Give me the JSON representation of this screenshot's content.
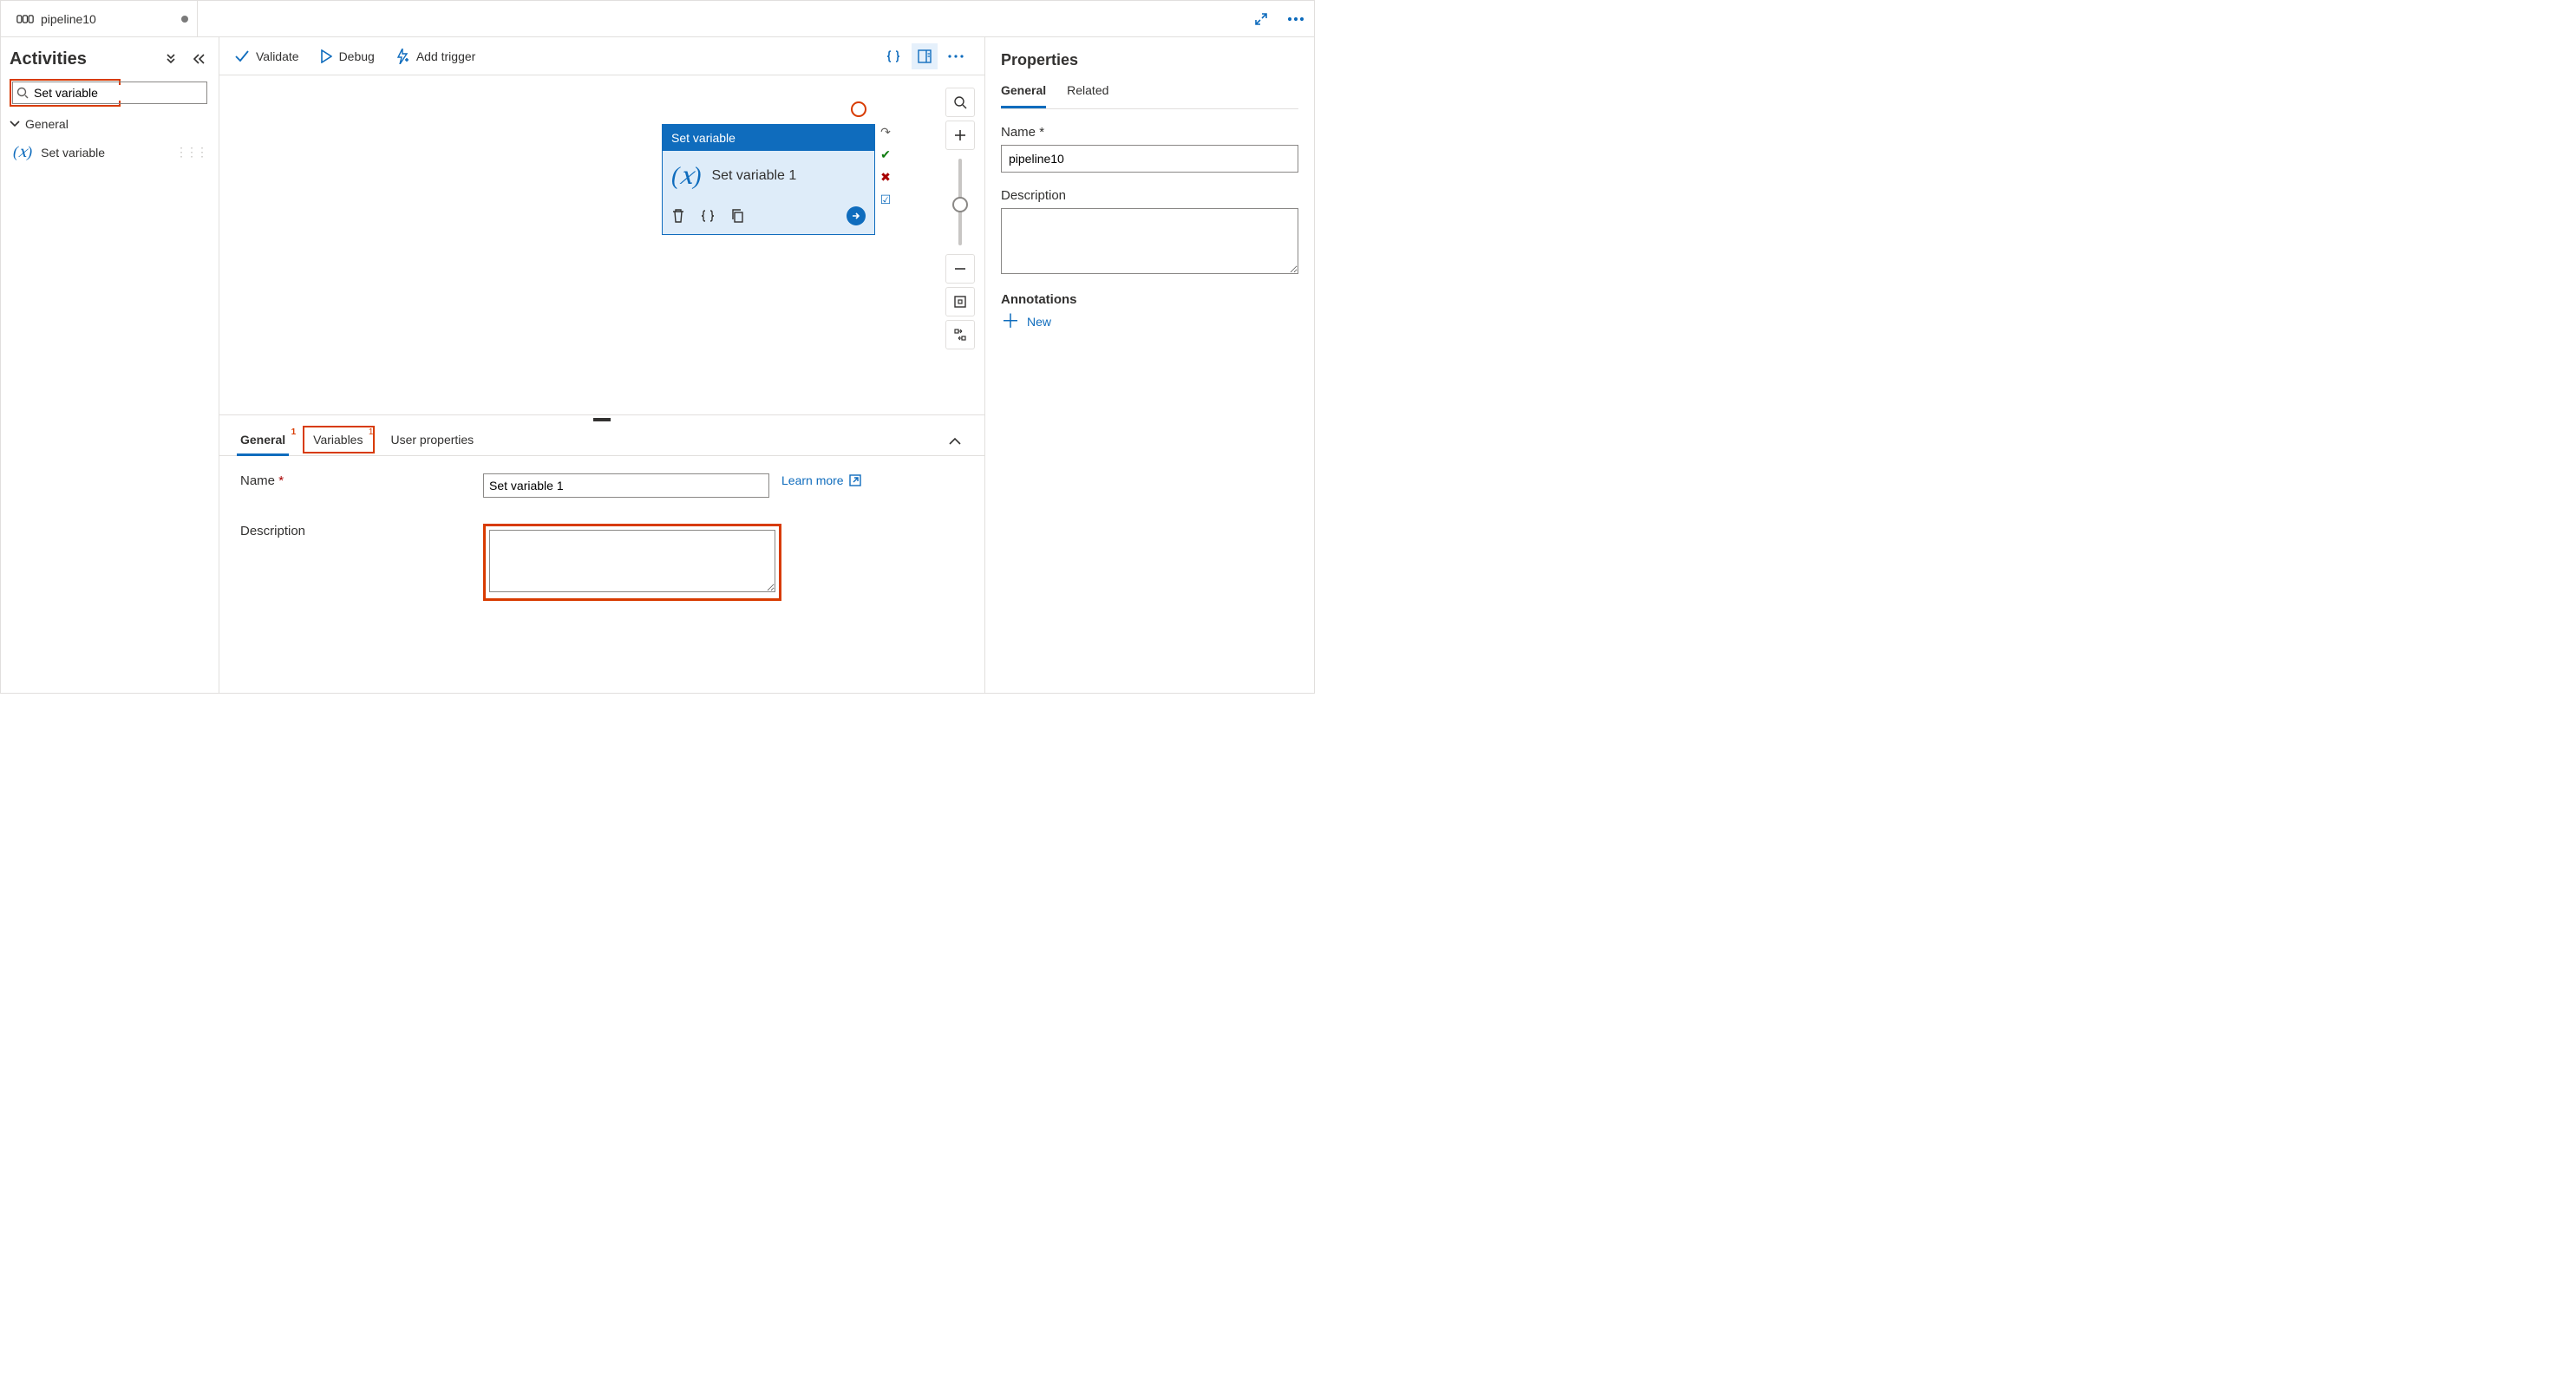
{
  "tab": {
    "title": "pipeline10"
  },
  "sidebar": {
    "title": "Activities",
    "search_value": "Set variable",
    "group_label": "General",
    "activity_label": "Set variable"
  },
  "toolbar": {
    "validate": "Validate",
    "debug": "Debug",
    "add_trigger": "Add trigger"
  },
  "node": {
    "type_label": "Set variable",
    "name": "Set variable 1"
  },
  "bottom": {
    "tabs": {
      "general": "General",
      "variables": "Variables",
      "user_props": "User properties",
      "badge": "1"
    },
    "name_label": "Name",
    "name_value": "Set variable 1",
    "desc_label": "Description",
    "desc_value": "",
    "learn_more": "Learn more"
  },
  "props": {
    "title": "Properties",
    "tabs": {
      "general": "General",
      "related": "Related"
    },
    "name_label": "Name",
    "name_value": "pipeline10",
    "desc_label": "Description",
    "desc_value": "",
    "ann_label": "Annotations",
    "ann_new": "New"
  }
}
